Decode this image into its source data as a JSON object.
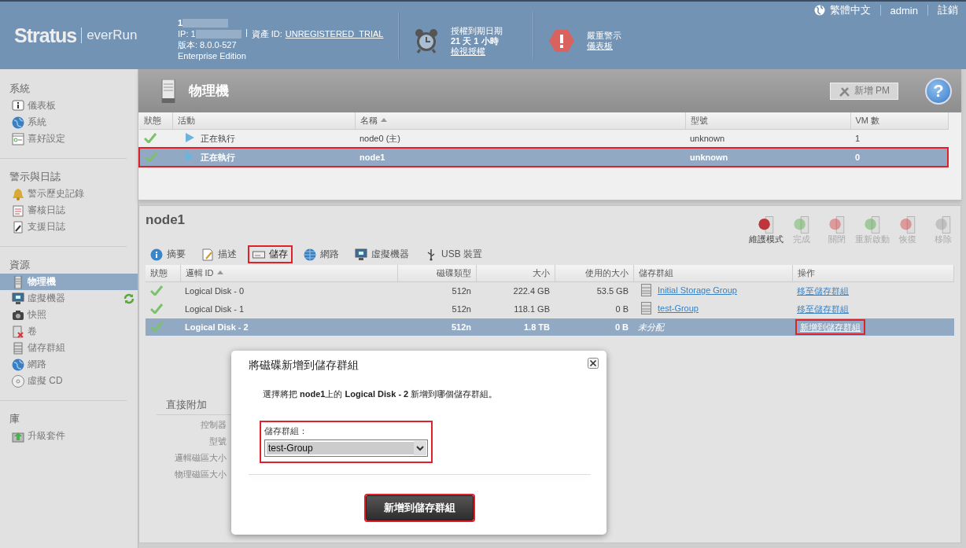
{
  "header": {
    "logo": {
      "brand": "Stratus",
      "product": "everRun"
    },
    "system": {
      "name": "1",
      "ip": "IP: 1",
      "asset_label": "資產 ID:",
      "asset_id": "UNREGISTERED_TRIAL",
      "version": "版本: 8.0.0-527",
      "edition": "Enterprise Edition"
    },
    "license": {
      "title": "授權到期日期",
      "remaining": "21 天 1 小時",
      "link": "檢視授權"
    },
    "alert": {
      "title": "嚴重警示",
      "link": "儀表板"
    },
    "top_links": [
      {
        "label": "繁體中文"
      },
      {
        "label": "admin"
      },
      {
        "label": "註銷"
      }
    ]
  },
  "sidebar": [
    {
      "title": "系統",
      "items": [
        {
          "label": "儀表板",
          "selected": false,
          "refreshing": false
        },
        {
          "label": "系統",
          "selected": false,
          "refreshing": false
        },
        {
          "label": "喜好設定",
          "selected": false,
          "refreshing": false
        }
      ]
    },
    {
      "title": "警示與日誌",
      "items": [
        {
          "label": "警示歷史記錄",
          "selected": false,
          "refreshing": false
        },
        {
          "label": "審核日誌",
          "selected": false,
          "refreshing": false
        },
        {
          "label": "支援日誌",
          "selected": false,
          "refreshing": false
        }
      ]
    },
    {
      "title": "資源",
      "items": [
        {
          "label": "物理機",
          "selected": true,
          "refreshing": false
        },
        {
          "label": "虛擬機器",
          "selected": false,
          "refreshing": true
        },
        {
          "label": "快照",
          "selected": false,
          "refreshing": false
        },
        {
          "label": "卷",
          "selected": false,
          "refreshing": false
        },
        {
          "label": "儲存群組",
          "selected": false,
          "refreshing": false
        },
        {
          "label": "網路",
          "selected": false,
          "refreshing": false
        },
        {
          "label": "虛擬 CD",
          "selected": false,
          "refreshing": false
        }
      ]
    },
    {
      "title": "庫",
      "items": [
        {
          "label": "升級套件",
          "selected": false,
          "refreshing": false
        }
      ]
    }
  ],
  "page": {
    "title": "物理機",
    "add_button": {
      "label": "新增 PM",
      "disabled": true
    },
    "help": "?"
  },
  "pm_table": {
    "columns": [
      {
        "label": "狀態",
        "sorted": false
      },
      {
        "label": "活動",
        "sorted": false
      },
      {
        "label": "名稱",
        "sorted": true
      },
      {
        "label": "型號",
        "sorted": false
      },
      {
        "label": "VM 數",
        "sorted": false
      }
    ],
    "rows": [
      {
        "ok": true,
        "activity": "正在執行",
        "name": "node0 (主)",
        "model": "unknown",
        "vm_count": "1",
        "selected": false,
        "highlighted": false
      },
      {
        "ok": true,
        "activity": "正在執行",
        "name": "node1",
        "model": "unknown",
        "vm_count": "0",
        "selected": true,
        "highlighted": true
      }
    ]
  },
  "node": {
    "title": "node1",
    "actions": [
      {
        "label": "維護模式",
        "disabled": false
      },
      {
        "label": "完成",
        "disabled": true
      },
      {
        "label": "關閉",
        "disabled": true
      },
      {
        "label": "重新啟動",
        "disabled": true
      },
      {
        "label": "恢復",
        "disabled": true
      },
      {
        "label": "移除",
        "disabled": true
      }
    ],
    "tabs": [
      {
        "label": "摘要",
        "selected": false,
        "highlighted": false
      },
      {
        "label": "描述",
        "selected": false,
        "highlighted": false
      },
      {
        "label": "儲存",
        "selected": true,
        "highlighted": true
      },
      {
        "label": "網路",
        "selected": false,
        "highlighted": false
      },
      {
        "label": "虛擬機器",
        "selected": false,
        "highlighted": false
      },
      {
        "label": "USB 裝置",
        "selected": false,
        "highlighted": false
      }
    ],
    "disk_table": {
      "columns": [
        {
          "label": "狀態",
          "sorted": false
        },
        {
          "label": "邏輯 ID",
          "sorted": true
        },
        {
          "label": "磁碟類型",
          "sorted": false
        },
        {
          "label": "大小",
          "sorted": false
        },
        {
          "label": "使用的大小",
          "sorted": false
        },
        {
          "label": "儲存群組",
          "sorted": false
        },
        {
          "label": "操作",
          "sorted": false
        }
      ],
      "rows": [
        {
          "ok": true,
          "id": "Logical Disk - 0",
          "disk_type": "512n",
          "size": "222.4 GB",
          "used": "53.5 GB",
          "group": "Initial Storage Group",
          "assigned": true,
          "action": "移至儲存群組",
          "selected": false,
          "highlighted": false
        },
        {
          "ok": true,
          "id": "Logical Disk - 1",
          "disk_type": "512n",
          "size": "118.1 GB",
          "used": "0 B",
          "group": "test-Group",
          "assigned": true,
          "action": "移至儲存群組",
          "selected": false,
          "highlighted": false
        },
        {
          "ok": true,
          "id": "Logical Disk - 2",
          "disk_type": "512n",
          "size": "1.8 TB",
          "used": "0 B",
          "group": "未分配",
          "assigned": false,
          "action": "新增到儲存群組",
          "selected": true,
          "highlighted": true
        }
      ]
    },
    "detail": {
      "title": "直接附加",
      "labels": [
        "控制器",
        "型號",
        "邏輯磁區大小",
        "物理磁區大小"
      ]
    }
  },
  "dialog": {
    "title": "將磁碟新增到儲存群組",
    "message": "選擇將把 **node1**上的 **Logical Disk - 2** 新增到哪個儲存群組。",
    "field": {
      "label": "儲存群組：",
      "value": "test-Group",
      "highlighted": true
    },
    "button": {
      "label": "新增到儲存群組",
      "highlighted": true
    }
  }
}
